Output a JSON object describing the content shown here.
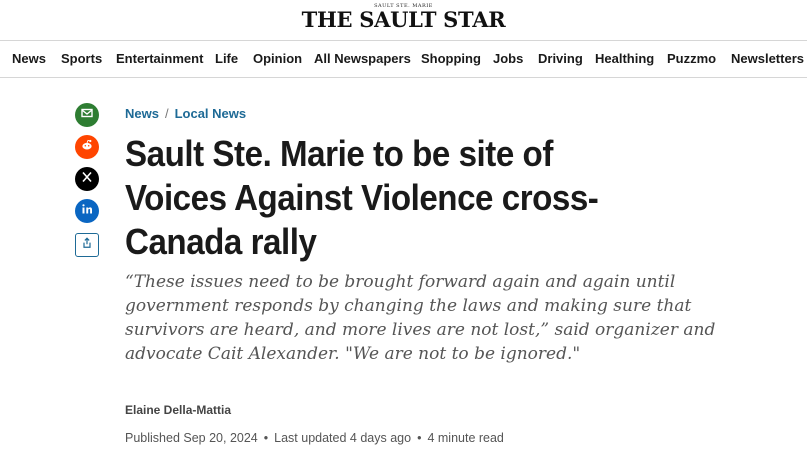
{
  "masthead": {
    "top_line": "SAULT STE. MARIE",
    "logo": "THE SAULT STAR"
  },
  "nav": [
    {
      "label": "News"
    },
    {
      "label": "Sports"
    },
    {
      "label": "Entertainment"
    },
    {
      "label": "Life"
    },
    {
      "label": "Opinion"
    },
    {
      "label": "All Newspapers"
    },
    {
      "label": "Shopping"
    },
    {
      "label": "Jobs"
    },
    {
      "label": "Driving"
    },
    {
      "label": "Healthing"
    },
    {
      "label": "Puzzmo"
    },
    {
      "label": "Newsletters"
    }
  ],
  "share": [
    {
      "icon": "email-icon",
      "color": "#2e7d32"
    },
    {
      "icon": "reddit-icon",
      "color": "#ff4500"
    },
    {
      "icon": "x-icon",
      "color": "#000000"
    },
    {
      "icon": "linkedin-icon",
      "color": "#0a66c2"
    },
    {
      "icon": "share-icon",
      "color": "#1e6a96"
    }
  ],
  "breadcrumb": {
    "section": "News",
    "subsection": "Local News",
    "separator": "/"
  },
  "article": {
    "headline": "Sault Ste. Marie to be site of Voices Against Violence cross-Canada rally",
    "dek": "“These issues need to be brought forward again and again until government responds by changing the laws and making sure that survivors are heard, and more lives are not lost,” said organizer and advocate Cait Alexander. \"We are not to be ignored.\"",
    "author": "Elaine Della-Mattia",
    "published": "Published Sep 20, 2024",
    "updated": "Last updated 4 days ago",
    "read_time": "4 minute read"
  }
}
